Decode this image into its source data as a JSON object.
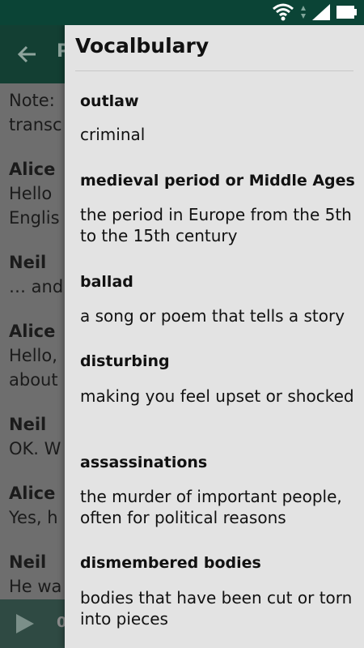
{
  "status_bar": {
    "icons": [
      "wifi-icon",
      "signal-icon",
      "battery-icon"
    ]
  },
  "app_bar": {
    "title_initial": "P"
  },
  "transcript": {
    "lines": [
      {
        "type": "note",
        "text": "Note:"
      },
      {
        "type": "note",
        "text": "transc"
      },
      {
        "type": "speaker",
        "text": "Alice"
      },
      {
        "type": "line",
        "text": "Hello"
      },
      {
        "type": "line",
        "text": "Englis"
      },
      {
        "type": "speaker",
        "text": "Neil"
      },
      {
        "type": "line",
        "text": "… and"
      },
      {
        "type": "speaker",
        "text": "Alice"
      },
      {
        "type": "line",
        "text": "Hello,"
      },
      {
        "type": "line",
        "text": "about"
      },
      {
        "type": "speaker",
        "text": "Neil"
      },
      {
        "type": "line",
        "text": "OK. W"
      },
      {
        "type": "speaker",
        "text": "Alice"
      },
      {
        "type": "line",
        "text": "Yes, h"
      },
      {
        "type": "speaker",
        "text": "Neil"
      },
      {
        "type": "line",
        "text": "He wa"
      }
    ]
  },
  "player": {
    "time": "0"
  },
  "drawer": {
    "title": "Vocalbulary",
    "items": [
      {
        "term": "outlaw",
        "definition": "criminal"
      },
      {
        "term": "medieval period or Middle Ages",
        "definition": "the period in Europe from the 5th to the 15th century"
      },
      {
        "term": "ballad",
        "definition": "a song or poem that tells a story"
      },
      {
        "term": "disturbing",
        "definition": "making you feel upset or shocked"
      },
      {
        "term": "assassinations",
        "definition": "the murder of important people, often for political reasons"
      },
      {
        "term": "dismembered bodies",
        "definition": "bodies that have been cut or torn into pieces"
      }
    ]
  },
  "colors": {
    "status_bar": "#0b4436",
    "app_bar": "#133f33",
    "drawer_bg": "#e3e3e3",
    "scrim": "#6f6f6f"
  }
}
